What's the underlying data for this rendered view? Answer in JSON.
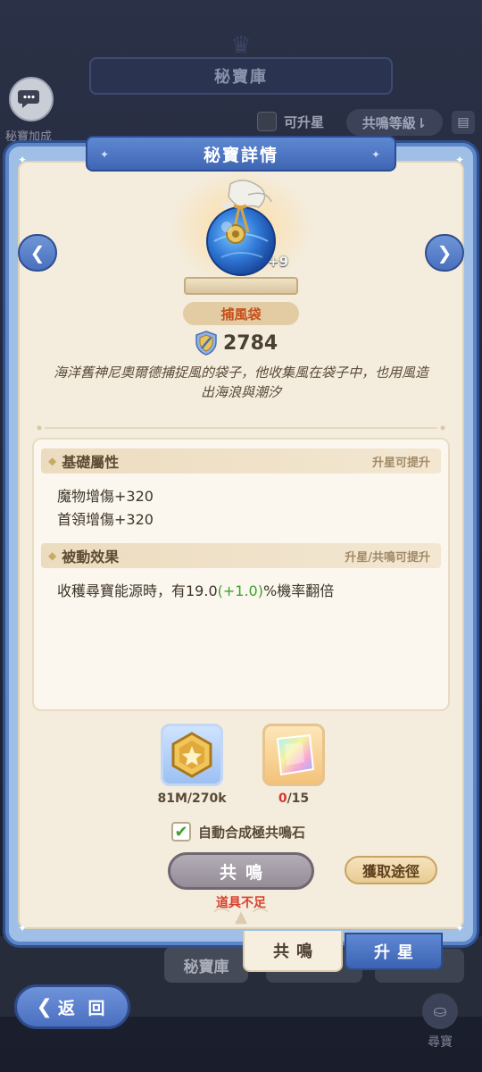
{
  "background": {
    "header_title": "秘寶庫",
    "side_label": "秘寶加成",
    "upgradable_label": "可升星",
    "sort_label": "共鳴等級⇂",
    "bottom_tab_vault": "秘寶庫",
    "back_label": "返 回",
    "treasure_hunt_label": "尋寶"
  },
  "modal": {
    "title": "秘寶詳情",
    "item": {
      "name": "捕風袋",
      "level_badge": "+9",
      "power": "2784",
      "description": "海洋舊神尼奧爾德捕捉風的袋子，他收集風在袋子中，也用風造出海浪與潮汐"
    },
    "base_attributes": {
      "title": "基礎屬性",
      "hint": "升星可提升",
      "lines": [
        "魔物增傷+320",
        "首領增傷+320"
      ]
    },
    "passive": {
      "title": "被動效果",
      "hint": "升星/共鳴可提升",
      "text_before": "收穫尋寶能源時，有19.0",
      "text_bonus": "(+1.0)",
      "text_after": "%機率翻倍"
    },
    "materials": [
      {
        "name": "gold-coin",
        "count": "81M/270k"
      },
      {
        "name": "resonance-stone",
        "have": "0",
        "need": "/15"
      }
    ],
    "auto_combine_label": "自動合成極共鳴石",
    "auto_combine_checked": true,
    "resonate_button": "共鳴",
    "obtain_button": "獲取途徑",
    "insufficient_text": "道具不足",
    "tabs": {
      "resonate": "共鳴",
      "upgrade": "升星"
    }
  },
  "colors": {
    "modal_border": "#5d86c9",
    "modal_bg": "#f4ecdc",
    "accent_blue": "#3f66b4",
    "name_color": "#c4501b",
    "bonus_green": "#3ea12f",
    "warning_red": "#d7402e"
  }
}
